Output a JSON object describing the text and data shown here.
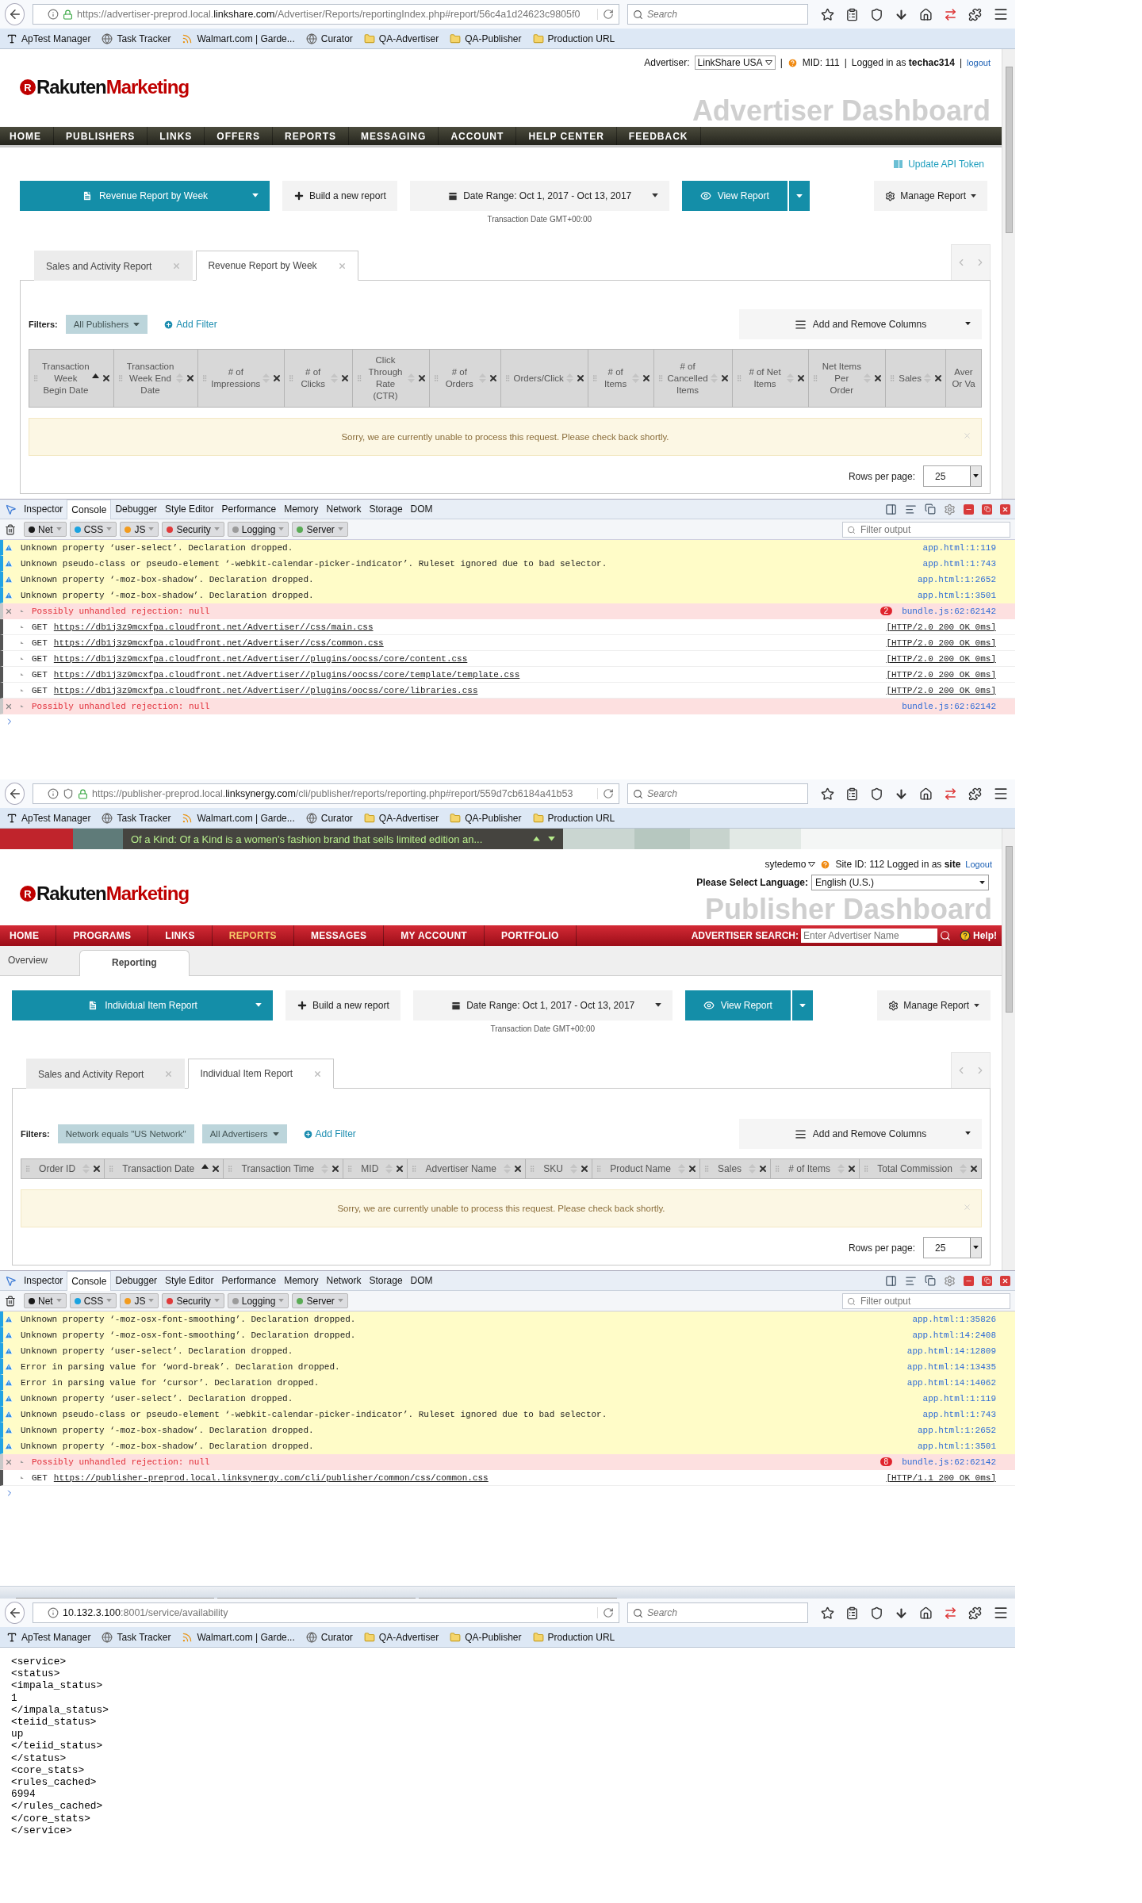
{
  "advertiser_window": {
    "browser": {
      "url": "https://advertiser-preprod.local.**linkshare.com**/Advertiser/Reports/reportingIndex.php#report/56c4a1d24623c9805f0",
      "secure": true,
      "tracking_protection": false,
      "search_placeholder": "Search",
      "bookmarks": [
        {
          "label": "ApTest Manager",
          "kind": "font"
        },
        {
          "label": "Task Tracker",
          "kind": "globe"
        },
        {
          "label": "Walmart.com | Garde...",
          "kind": "feed"
        },
        {
          "label": "Curator",
          "kind": "globe"
        },
        {
          "label": "QA-Advertiser",
          "kind": "folder"
        },
        {
          "label": "QA-Publisher",
          "kind": "folder"
        },
        {
          "label": "Production URL",
          "kind": "folder"
        }
      ]
    },
    "header": {
      "items": [
        {
          "kind": "label",
          "text": "Advertiser:"
        },
        {
          "kind": "select",
          "text": "LinkShare USA"
        },
        {
          "kind": "separator",
          "text": "|"
        },
        {
          "kind": "help",
          "text": "MID: 111"
        },
        {
          "kind": "separator",
          "text": "|"
        },
        {
          "kind": "text",
          "text": "Logged in as **techac314**"
        },
        {
          "kind": "separator",
          "text": "|"
        },
        {
          "kind": "link",
          "text": "logout"
        }
      ]
    },
    "logo": {
      "mark": "R",
      "name": "Rakuten",
      "accent": "Marketing"
    },
    "watermark": "Advertiser Dashboard",
    "nav": [
      {
        "label": "HOME",
        "selected": false
      },
      {
        "label": "PUBLISHERS",
        "selected": false
      },
      {
        "label": "LINKS",
        "selected": false
      },
      {
        "label": "OFFERS",
        "selected": false
      },
      {
        "label": "REPORTS",
        "selected": false
      },
      {
        "label": "MESSAGING",
        "selected": false
      },
      {
        "label": "ACCOUNT",
        "selected": false
      },
      {
        "label": "HELP CENTER",
        "selected": false
      },
      {
        "label": "FEEDBACK",
        "selected": false
      }
    ],
    "api_link": "Update API Token",
    "toolbar": {
      "report": "Revenue Report by Week",
      "build": "Build a new report",
      "date_range": "Date Range: Oct 1, 2017 - Oct 13, 2017",
      "view": "View Report",
      "manage": "Manage Report",
      "note": "Transaction Date GMT+00:00"
    },
    "report_tabs": [
      {
        "label": "Sales and Activity Report",
        "selected": false
      },
      {
        "label": "Revenue Report by Week",
        "selected": true
      }
    ],
    "filters": {
      "label": "Filters:",
      "chips": [
        {
          "label": "All Publishers",
          "kind": "dropdown"
        }
      ],
      "add": "Add Filter",
      "columns_button": "Add and Remove Columns"
    },
    "columns": [
      {
        "label": "Transaction Week Begin Date",
        "sorted": true,
        "cut": false
      },
      {
        "label": "Transaction Week End Date",
        "sorted": false,
        "cut": false
      },
      {
        "label": "# of Impressions",
        "sorted": false,
        "cut": false
      },
      {
        "label": "# of Clicks",
        "sorted": false,
        "cut": false
      },
      {
        "label": "Click Through Rate (CTR)",
        "sorted": false,
        "cut": false
      },
      {
        "label": "# of Orders",
        "sorted": false,
        "cut": false
      },
      {
        "label": "Orders/Click",
        "sorted": false,
        "cut": false
      },
      {
        "label": "# of Items",
        "sorted": false,
        "cut": false
      },
      {
        "label": "# of Cancelled Items",
        "sorted": false,
        "cut": false
      },
      {
        "label": "# of Net Items",
        "sorted": false,
        "cut": false
      },
      {
        "label": "Net Items Per Order",
        "sorted": false,
        "cut": false
      },
      {
        "label": "Sales",
        "sorted": false,
        "cut": false
      },
      {
        "label": "Aver Or Va",
        "cut": true
      }
    ],
    "alert": "Sorry, we are currently unable to process this request. Please check back shortly.",
    "rows_per_page": {
      "label": "Rows per page:",
      "value": "25"
    },
    "devtools": {
      "tabs": [
        {
          "label": "Inspector",
          "selected": false
        },
        {
          "label": "Console",
          "selected": true
        },
        {
          "label": "Debugger",
          "selected": false
        },
        {
          "label": "Style Editor",
          "selected": false
        },
        {
          "label": "Performance",
          "selected": false
        },
        {
          "label": "Memory",
          "selected": false
        },
        {
          "label": "Network",
          "selected": false
        },
        {
          "label": "Storage",
          "selected": false
        },
        {
          "label": "DOM",
          "selected": false
        }
      ],
      "filters": [
        {
          "label": "Net",
          "color": "#1a1a1a"
        },
        {
          "label": "CSS",
          "color": "#1aa3e0"
        },
        {
          "label": "JS",
          "color": "#f29b1d"
        },
        {
          "label": "Security",
          "color": "#e03a3a"
        },
        {
          "label": "Logging",
          "color": "#9b9b9b"
        },
        {
          "label": "Server",
          "color": "#5aab55"
        }
      ],
      "filter_placeholder": "Filter output",
      "rows": [
        {
          "kind": "warning",
          "text": "Unknown property ‘user-select’. Declaration dropped.",
          "source": "app.html:1:119"
        },
        {
          "kind": "warning",
          "text": "Unknown pseudo-class or pseudo-element ‘-webkit-calendar-picker-indicator’. Ruleset ignored due to bad selector.",
          "source": "app.html:1:743"
        },
        {
          "kind": "warning",
          "text": "Unknown property ‘-moz-box-shadow’. Declaration dropped.",
          "source": "app.html:1:2652"
        },
        {
          "kind": "warning",
          "text": "Unknown property ‘-moz-box-shadow’. Declaration dropped.",
          "source": "app.html:1:3501"
        },
        {
          "kind": "error",
          "text": "Possibly unhandled rejection: null",
          "count": "2",
          "source": "bundle.js:62:62142"
        },
        {
          "kind": "request",
          "method": "GET",
          "url": "https://db1j3z9mcxfpa.cloudfront.net/Advertiser//css/main.css",
          "status": "[HTTP/2.0 200 OK 0ms]"
        },
        {
          "kind": "request",
          "method": "GET",
          "url": "https://db1j3z9mcxfpa.cloudfront.net/Advertiser//css/common.css",
          "status": "[HTTP/2.0 200 OK 0ms]"
        },
        {
          "kind": "request",
          "method": "GET",
          "url": "https://db1j3z9mcxfpa.cloudfront.net/Advertiser//plugins/oocss/core/content.css",
          "status": "[HTTP/2.0 200 OK 0ms]"
        },
        {
          "kind": "request",
          "method": "GET",
          "url": "https://db1j3z9mcxfpa.cloudfront.net/Advertiser//plugins/oocss/core/template/template.css",
          "status": "[HTTP/2.0 200 OK 0ms]"
        },
        {
          "kind": "request",
          "method": "GET",
          "url": "https://db1j3z9mcxfpa.cloudfront.net/Advertiser//plugins/oocss/core/libraries.css",
          "status": "[HTTP/2.0 200 OK 0ms]"
        },
        {
          "kind": "error",
          "text": "Possibly unhandled rejection: null",
          "source": "bundle.js:62:62142"
        }
      ]
    }
  },
  "publisher_window": {
    "browser": {
      "url": "https://publisher-preprod.local.**linksynergy.com**/cli/publisher/reports/reporting.php#report/559d7cb6184a41b53",
      "secure": true,
      "tracking_protection": true,
      "search_placeholder": "Search",
      "bookmarks": [
        {
          "label": "ApTest Manager",
          "kind": "font"
        },
        {
          "label": "Task Tracker",
          "kind": "globe"
        },
        {
          "label": "Walmart.com | Garde...",
          "kind": "feed"
        },
        {
          "label": "Curator",
          "kind": "globe"
        },
        {
          "label": "QA-Advertiser",
          "kind": "folder"
        },
        {
          "label": "QA-Publisher",
          "kind": "folder"
        },
        {
          "label": "Production URL",
          "kind": "folder"
        }
      ]
    },
    "ticker": {
      "text": "Of a Kind: Of a Kind is a women's fashion brand that sells limited edition an..."
    },
    "header": {
      "items": [
        {
          "kind": "user",
          "text": "sytedemo"
        },
        {
          "kind": "help",
          "text": "Site ID: 112 Logged in as **site**"
        },
        {
          "kind": "link",
          "text": "Logout"
        }
      ],
      "language_label": "Please Select Language:",
      "language": "English (U.S.)"
    },
    "logo": {
      "mark": "R",
      "name": "Rakuten",
      "accent": "Marketing"
    },
    "watermark": "Publisher Dashboard",
    "nav": [
      {
        "label": "HOME",
        "selected": false
      },
      {
        "label": "PROGRAMS",
        "selected": false
      },
      {
        "label": "LINKS",
        "selected": false
      },
      {
        "label": "REPORTS",
        "selected": true
      },
      {
        "label": "MESSAGES",
        "selected": false
      },
      {
        "label": "MY ACCOUNT",
        "selected": false
      },
      {
        "label": "PORTFOLIO",
        "selected": false
      }
    ],
    "nav_search": {
      "label": "ADVERTISER SEARCH:",
      "placeholder": "Enter Advertiser Name",
      "help": "Help!"
    },
    "subtabs": [
      {
        "label": "Overview",
        "selected": false
      },
      {
        "label": "Reporting",
        "selected": true
      }
    ],
    "toolbar": {
      "report": "Individual Item Report",
      "build": "Build a new report",
      "date_range": "Date Range: Oct 1, 2017 - Oct 13, 2017",
      "view": "View Report",
      "manage": "Manage Report",
      "note": "Transaction Date GMT+00:00"
    },
    "report_tabs": [
      {
        "label": "Sales and Activity Report",
        "selected": false
      },
      {
        "label": "Individual Item Report",
        "selected": true
      }
    ],
    "filters": {
      "label": "Filters:",
      "chips": [
        {
          "label": "Network equals \"US Network\"",
          "kind": "plain"
        },
        {
          "label": "All Advertisers",
          "kind": "dropdown"
        }
      ],
      "add": "Add Filter",
      "columns_button": "Add and Remove Columns"
    },
    "columns": [
      {
        "label": "Order ID",
        "sorted": false,
        "cut": false
      },
      {
        "label": "Transaction Date",
        "sorted": true,
        "cut": false
      },
      {
        "label": "Transaction Time",
        "sorted": false,
        "cut": false
      },
      {
        "label": "MID",
        "sorted": false,
        "cut": false
      },
      {
        "label": "Advertiser Name",
        "sorted": false,
        "cut": false
      },
      {
        "label": "SKU",
        "sorted": false,
        "cut": false
      },
      {
        "label": "Product Name",
        "sorted": false,
        "cut": false
      },
      {
        "label": "Sales",
        "sorted": false,
        "cut": false
      },
      {
        "label": "# of Items",
        "sorted": false,
        "cut": false
      },
      {
        "label": "Total Commission",
        "sorted": false,
        "cut": false
      }
    ],
    "alert": "Sorry, we are currently unable to process this request. Please check back shortly.",
    "rows_per_page": {
      "label": "Rows per page:",
      "value": "25"
    },
    "devtools": {
      "tabs": [
        {
          "label": "Inspector",
          "selected": false
        },
        {
          "label": "Console",
          "selected": true
        },
        {
          "label": "Debugger",
          "selected": false
        },
        {
          "label": "Style Editor",
          "selected": false
        },
        {
          "label": "Performance",
          "selected": false
        },
        {
          "label": "Memory",
          "selected": false
        },
        {
          "label": "Network",
          "selected": false
        },
        {
          "label": "Storage",
          "selected": false
        },
        {
          "label": "DOM",
          "selected": false
        }
      ],
      "filters": [
        {
          "label": "Net",
          "color": "#1a1a1a"
        },
        {
          "label": "CSS",
          "color": "#1aa3e0"
        },
        {
          "label": "JS",
          "color": "#f29b1d"
        },
        {
          "label": "Security",
          "color": "#e03a3a"
        },
        {
          "label": "Logging",
          "color": "#9b9b9b"
        },
        {
          "label": "Server",
          "color": "#5aab55"
        }
      ],
      "filter_placeholder": "Filter output",
      "rows": [
        {
          "kind": "warning",
          "text": "Unknown property ‘-moz-osx-font-smoothing’. Declaration dropped.",
          "source": "app.html:1:35826"
        },
        {
          "kind": "warning",
          "text": "Unknown property ‘-moz-osx-font-smoothing’. Declaration dropped.",
          "source": "app.html:14:2408"
        },
        {
          "kind": "warning",
          "text": "Unknown property ‘user-select’. Declaration dropped.",
          "source": "app.html:14:12809"
        },
        {
          "kind": "warning",
          "text": "Error in parsing value for ‘word-break’. Declaration dropped.",
          "source": "app.html:14:13435"
        },
        {
          "kind": "warning",
          "text": "Error in parsing value for ‘cursor’. Declaration dropped.",
          "source": "app.html:14:14062"
        },
        {
          "kind": "warning",
          "text": "Unknown property ‘user-select’. Declaration dropped.",
          "source": "app.html:1:119"
        },
        {
          "kind": "warning",
          "text": "Unknown pseudo-class or pseudo-element ‘-webkit-calendar-picker-indicator’. Ruleset ignored due to bad selector.",
          "source": "app.html:1:743"
        },
        {
          "kind": "warning",
          "text": "Unknown property ‘-moz-box-shadow’. Declaration dropped.",
          "source": "app.html:1:2652"
        },
        {
          "kind": "warning",
          "text": "Unknown property ‘-moz-box-shadow’. Declaration dropped.",
          "source": "app.html:1:3501"
        },
        {
          "kind": "error",
          "text": "Possibly unhandled rejection: null",
          "count": "8",
          "source": "bundle.js:62:62142"
        },
        {
          "kind": "request",
          "method": "GET",
          "url": "https://publisher-preprod.local.linksynergy.com/cli/publisher/common/css/common.css",
          "status": "[HTTP/1.1 200 OK 0ms]"
        }
      ]
    }
  },
  "service_window": {
    "browser": {
      "url": "**10.132.3.100**:8001/service/availability",
      "secure": false,
      "tracking_protection": false,
      "search_placeholder": "Search",
      "bookmarks": [
        {
          "label": "ApTest Manager",
          "kind": "font"
        },
        {
          "label": "Task Tracker",
          "kind": "globe"
        },
        {
          "label": "Walmart.com | Garde...",
          "kind": "feed"
        },
        {
          "label": "Curator",
          "kind": "globe"
        },
        {
          "label": "QA-Advertiser",
          "kind": "folder"
        },
        {
          "label": "QA-Publisher",
          "kind": "folder"
        },
        {
          "label": "Production URL",
          "kind": "folder"
        }
      ]
    },
    "lines": [
      "<service>",
      "<status>",
      "<impala_status>",
      "1",
      "</impala_status>",
      "<teiid_status>",
      "up",
      "</teiid_status>",
      "</status>",
      "<core_stats>",
      "<rules_cached>",
      "6994",
      "</rules_cached>",
      "</core_stats>",
      "</service>"
    ]
  }
}
